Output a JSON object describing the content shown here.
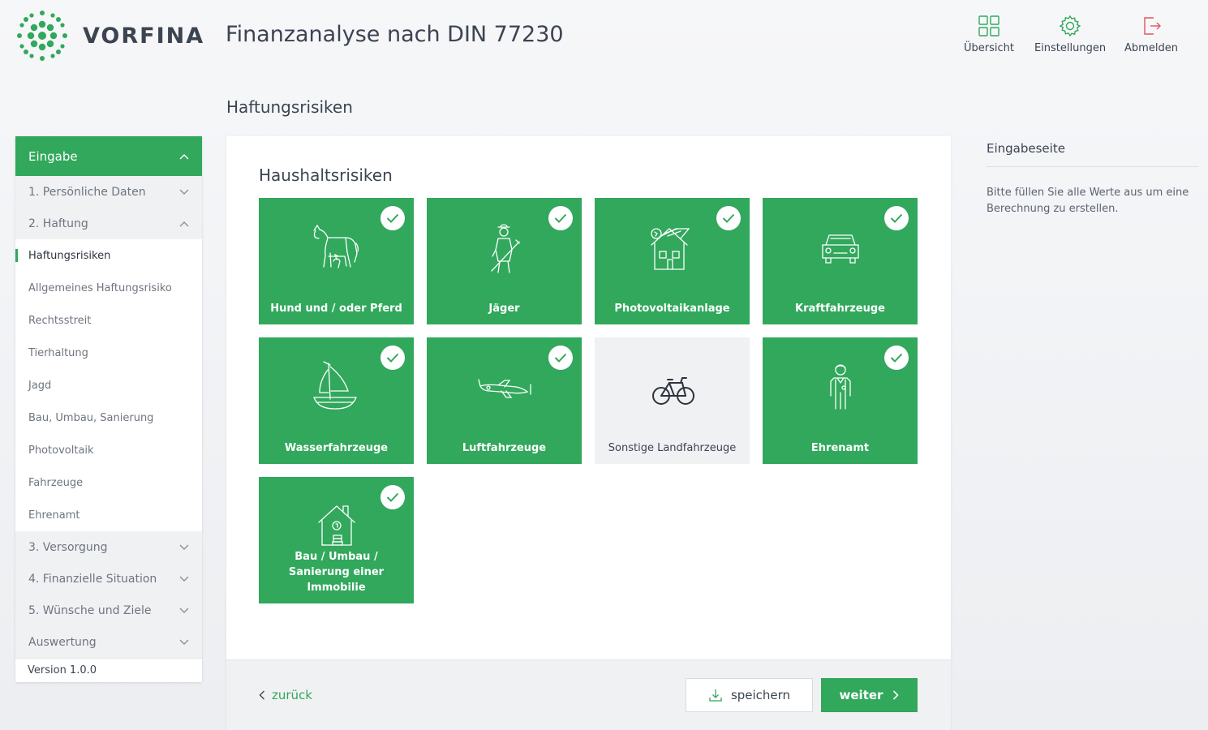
{
  "brand": {
    "name": "VORFINA",
    "accent": "#31a85c"
  },
  "header": {
    "title": "Finanzanalyse nach DIN 77230",
    "nav": [
      {
        "label": "Übersicht",
        "icon": "grid-icon"
      },
      {
        "label": "Einstellungen",
        "icon": "gear-icon"
      },
      {
        "label": "Abmelden",
        "icon": "logout-icon"
      }
    ]
  },
  "page": {
    "title": "Haftungsrisiken"
  },
  "sidebar": {
    "header": "Eingabe",
    "sections": [
      {
        "label": "1. Persönliche Daten",
        "expanded": false
      },
      {
        "label": "2. Haftung",
        "expanded": true
      },
      {
        "label": "3. Versorgung",
        "expanded": false
      },
      {
        "label": "4. Finanzielle Situation",
        "expanded": false
      },
      {
        "label": "5. Wünsche und Ziele",
        "expanded": false
      },
      {
        "label": "Auswertung",
        "expanded": false
      }
    ],
    "haftung_items": [
      "Haftungsrisiken",
      "Allgemeines Haftungsrisiko",
      "Rechtsstreit",
      "Tierhaltung",
      "Jagd",
      "Bau, Umbau, Sanierung",
      "Photovoltaik",
      "Fahrzeuge",
      "Ehrenamt"
    ],
    "active_item": "Haftungsrisiken",
    "version": "Version 1.0.0"
  },
  "card": {
    "title": "Haushaltsrisiken",
    "tiles": [
      {
        "label": "Hund und / oder Pferd",
        "icon": "horse-dog-icon",
        "selected": true
      },
      {
        "label": "Jäger",
        "icon": "hunter-icon",
        "selected": true
      },
      {
        "label": "Photovoltaikanlage",
        "icon": "solar-house-icon",
        "selected": true
      },
      {
        "label": "Kraftfahrzeuge",
        "icon": "car-icon",
        "selected": true
      },
      {
        "label": "Wasserfahrzeuge",
        "icon": "sailboat-icon",
        "selected": true
      },
      {
        "label": "Luftfahrzeuge",
        "icon": "airplane-icon",
        "selected": true
      },
      {
        "label": "Sonstige Landfahrzeuge",
        "icon": "bicycle-icon",
        "selected": false
      },
      {
        "label": "Ehrenamt",
        "icon": "volunteer-icon",
        "selected": true
      },
      {
        "label": "Bau / Umbau / Sanierung einer Immobilie",
        "icon": "house-money-icon",
        "selected": true
      }
    ]
  },
  "footer": {
    "back": "zurück",
    "save": "speichern",
    "next": "weiter"
  },
  "info": {
    "title": "Eingabeseite",
    "text": "Bitte füllen Sie alle Werte aus um eine Berechnung zu erstellen."
  }
}
